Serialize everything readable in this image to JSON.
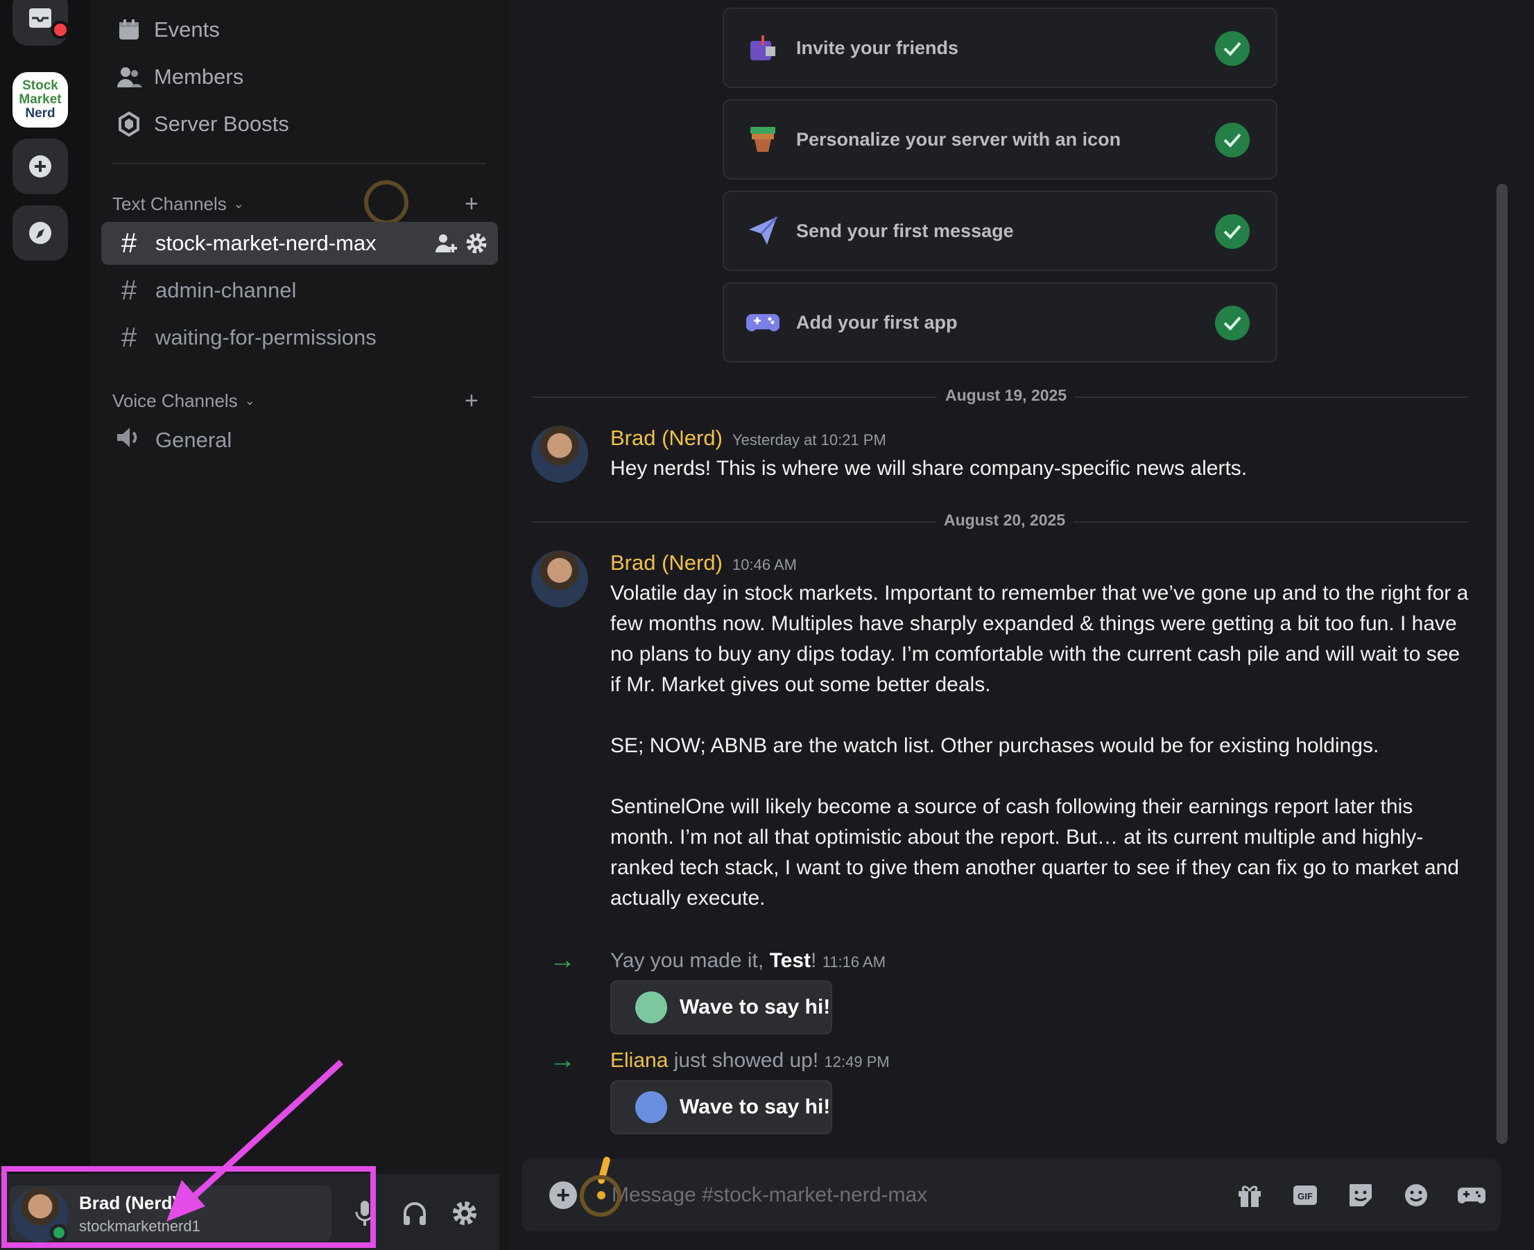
{
  "rail": {
    "server_logo": [
      "Stock",
      "Market",
      "Nerd"
    ]
  },
  "sidebar": {
    "top_items": [
      {
        "label": "Events",
        "icon": "calendar-icon"
      },
      {
        "label": "Members",
        "icon": "members-icon"
      },
      {
        "label": "Server Boosts",
        "icon": "boost-icon"
      }
    ],
    "text_category": "Text Channels",
    "voice_category": "Voice Channels",
    "text_channels": [
      "stock-market-nerd-max",
      "admin-channel",
      "waiting-for-permissions"
    ],
    "voice_channels": [
      "General"
    ]
  },
  "user": {
    "name": "Brad (Nerd)",
    "tag": "stockmarketnerd1"
  },
  "checklist": [
    {
      "label": "Invite your friends",
      "icon": "mailbox-icon",
      "done": true
    },
    {
      "label": "Personalize your server with an icon",
      "icon": "pot-icon",
      "done": true
    },
    {
      "label": "Send your first message",
      "icon": "paper-plane-icon",
      "done": true
    },
    {
      "label": "Add your first app",
      "icon": "gamepad-icon",
      "done": true
    }
  ],
  "dates": [
    "August 19, 2025",
    "August 20, 2025"
  ],
  "messages": [
    {
      "author": "Brad (Nerd)",
      "time": "Yesterday at 10:21 PM",
      "paragraphs": [
        "Hey nerds! This is where we will share company-specific news alerts."
      ]
    },
    {
      "author": "Brad (Nerd)",
      "time": "10:46 AM",
      "paragraphs": [
        "Volatile day in stock markets. Important to remember that we’ve gone up and to the right for a few months now. Multiples have sharply expanded & things were getting a bit too fun. I have no plans to buy any dips today. I’m comfortable with the current cash pile and will wait to see if Mr. Market gives out some better deals.",
        "SE; NOW; ABNB are the watch list. Other purchases would be for existing holdings.",
        "SentinelOne will likely become a source of cash following their earnings report later this month. I’m not all that optimistic about the report. But… at its current multiple and highly-ranked tech stack, I want to give them another quarter to see if they can fix go to market and actually execute."
      ]
    }
  ],
  "joins": [
    {
      "prefix": "Yay you made it, ",
      "name": "Test",
      "suffix": "!",
      "time": "11:16 AM",
      "button": "Wave to say hi!"
    },
    {
      "prefix": "",
      "name": "Eliana",
      "suffix": " just showed up!",
      "time": "12:49 PM",
      "button": "Wave to say hi!"
    }
  ],
  "composer": {
    "placeholder": "Message #stock-market-nerd-max"
  },
  "colors": {
    "accent_yellow": "#f0c14b",
    "success_green": "#248046",
    "highlight_magenta": "#e34ce6"
  }
}
